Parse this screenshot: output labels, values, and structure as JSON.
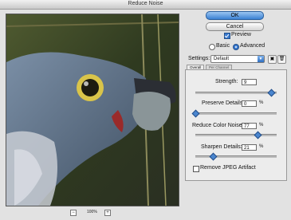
{
  "window": {
    "title": "Reduce Noise"
  },
  "buttons": {
    "ok": "OK",
    "cancel": "Cancel"
  },
  "preview_toggle": {
    "label": "Preview",
    "checked": true
  },
  "mode": {
    "basic": "Basic",
    "advanced": "Advanced",
    "selected": "advanced"
  },
  "settings": {
    "label": "Settings:",
    "value": "Default",
    "icons": [
      "save-settings-icon",
      "delete-settings-icon"
    ]
  },
  "tabs": [
    {
      "label": "Overall",
      "active": true
    },
    {
      "label": "Per Channel",
      "active": false
    }
  ],
  "controls": [
    {
      "label": "Strength:",
      "value": "9",
      "unit": "",
      "fraction": 0.9
    },
    {
      "label": "Preserve Details:",
      "value": "0",
      "unit": "%",
      "fraction": 0.0
    },
    {
      "label": "Reduce Color Noise:",
      "value": "77",
      "unit": "%",
      "fraction": 0.77
    },
    {
      "label": "Sharpen Details:",
      "value": "21",
      "unit": "%",
      "fraction": 0.21
    }
  ],
  "jpeg_artifact": {
    "label": "Remove JPEG Artifact",
    "checked": false
  },
  "zoom": {
    "minus": "−",
    "value": "100%",
    "plus": "+"
  },
  "colors": {
    "accent": "#3a7bd0",
    "panel": "#e2e2e2"
  }
}
